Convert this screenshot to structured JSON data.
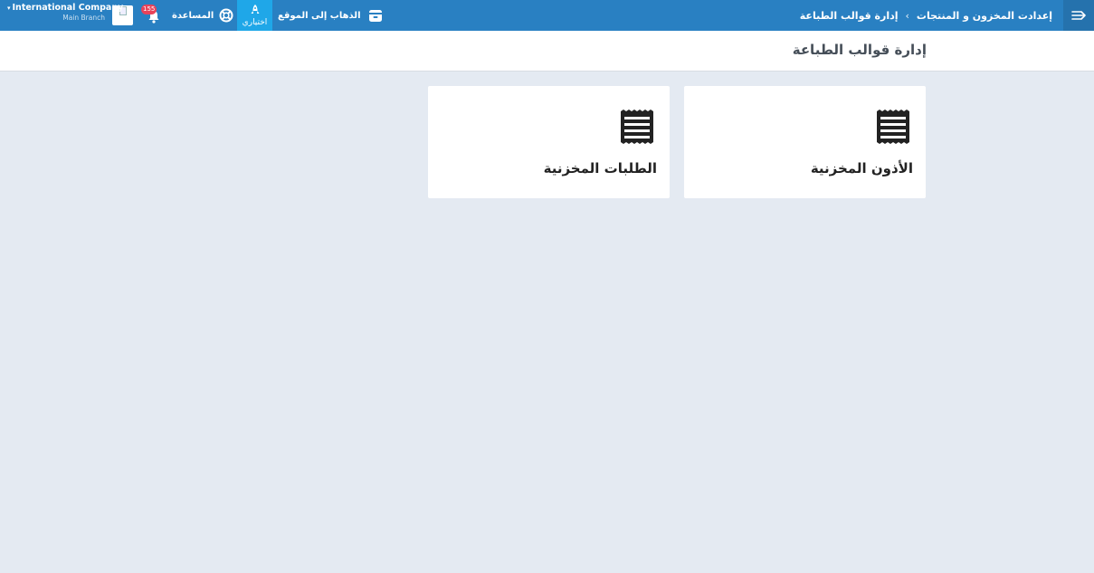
{
  "topbar": {
    "breadcrumb": [
      {
        "label": "إعدادت المخزون و المنتجات"
      },
      {
        "separator": "›"
      },
      {
        "label": "إدارة قوالب الطباعة"
      }
    ],
    "go_to_site_label": "الذهاب إلى الموقع",
    "my_selection_label": "اختياري",
    "help_label": "المساعدة",
    "notifications_count": "155",
    "company_name": "International Company",
    "branch_name": "Main Branch"
  },
  "page": {
    "title": "إدارة قوالب الطباعة"
  },
  "cards": [
    {
      "label": "الأذون المخزنية",
      "icon": "receipt-icon"
    },
    {
      "label": "الطلبات المخزنية",
      "icon": "receipt-icon"
    }
  ],
  "colors": {
    "topbar": "#2980c2",
    "toggle": "#2572ad",
    "highlight": "#1fa7e8",
    "background": "#e4eaf2",
    "badge": "#e8435a"
  }
}
